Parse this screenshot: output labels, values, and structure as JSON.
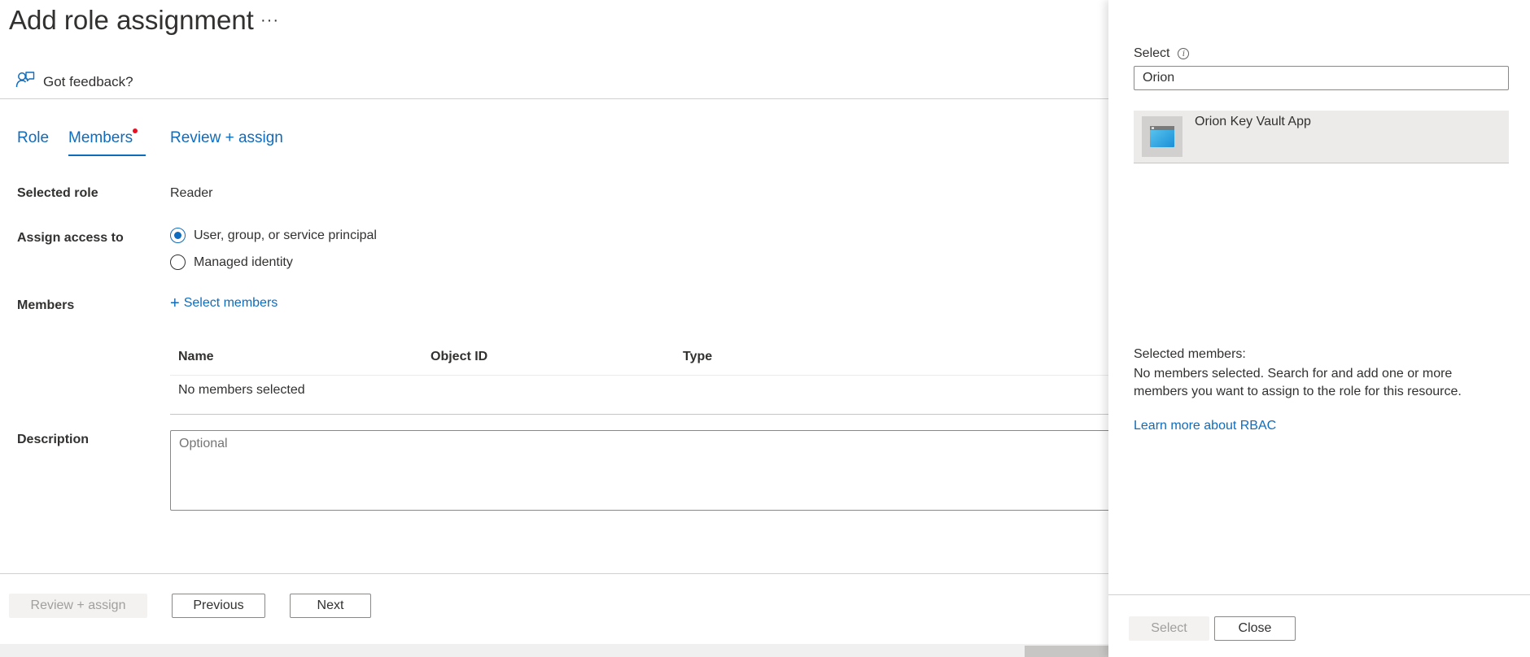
{
  "header": {
    "title": "Add role assignment",
    "more_label": "···",
    "feedback_label": "Got feedback?"
  },
  "tabs": [
    {
      "label": "Role",
      "active": false
    },
    {
      "label": "Members",
      "active": true,
      "has_notification_dot": true
    },
    {
      "label": "Review + assign",
      "active": false
    }
  ],
  "form": {
    "selected_role_label": "Selected role",
    "selected_role_value": "Reader",
    "assign_access_label": "Assign access to",
    "assign_options": [
      {
        "label": "User, group, or service principal",
        "selected": true
      },
      {
        "label": "Managed identity",
        "selected": false
      }
    ],
    "members_label": "Members",
    "select_members_label": "Select members",
    "table": {
      "columns": [
        "Name",
        "Object ID",
        "Type"
      ],
      "empty_text": "No members selected"
    },
    "description_label": "Description",
    "description_placeholder": "Optional",
    "description_value": ""
  },
  "footer": {
    "review_assign_label": "Review + assign",
    "review_assign_disabled": true,
    "previous_label": "Previous",
    "next_label": "Next"
  },
  "side_panel": {
    "select_label": "Select",
    "search_value": "Orion",
    "results": [
      {
        "name": "Orion Key Vault App",
        "icon": "app-registration-icon"
      }
    ],
    "selected_members_title": "Selected members:",
    "selected_members_text": "No members selected. Search for and add one or more members you want to assign to the role for this resource.",
    "learn_more_label": "Learn more about RBAC",
    "select_button_label": "Select",
    "select_button_disabled": true,
    "close_button_label": "Close"
  },
  "colors": {
    "accent": "#0f6cbd",
    "notification_dot": "#e81123",
    "text": "#323130",
    "disabled_bg": "#f3f2f1",
    "disabled_text": "#a19f9d",
    "result_bg": "#edebe9"
  }
}
